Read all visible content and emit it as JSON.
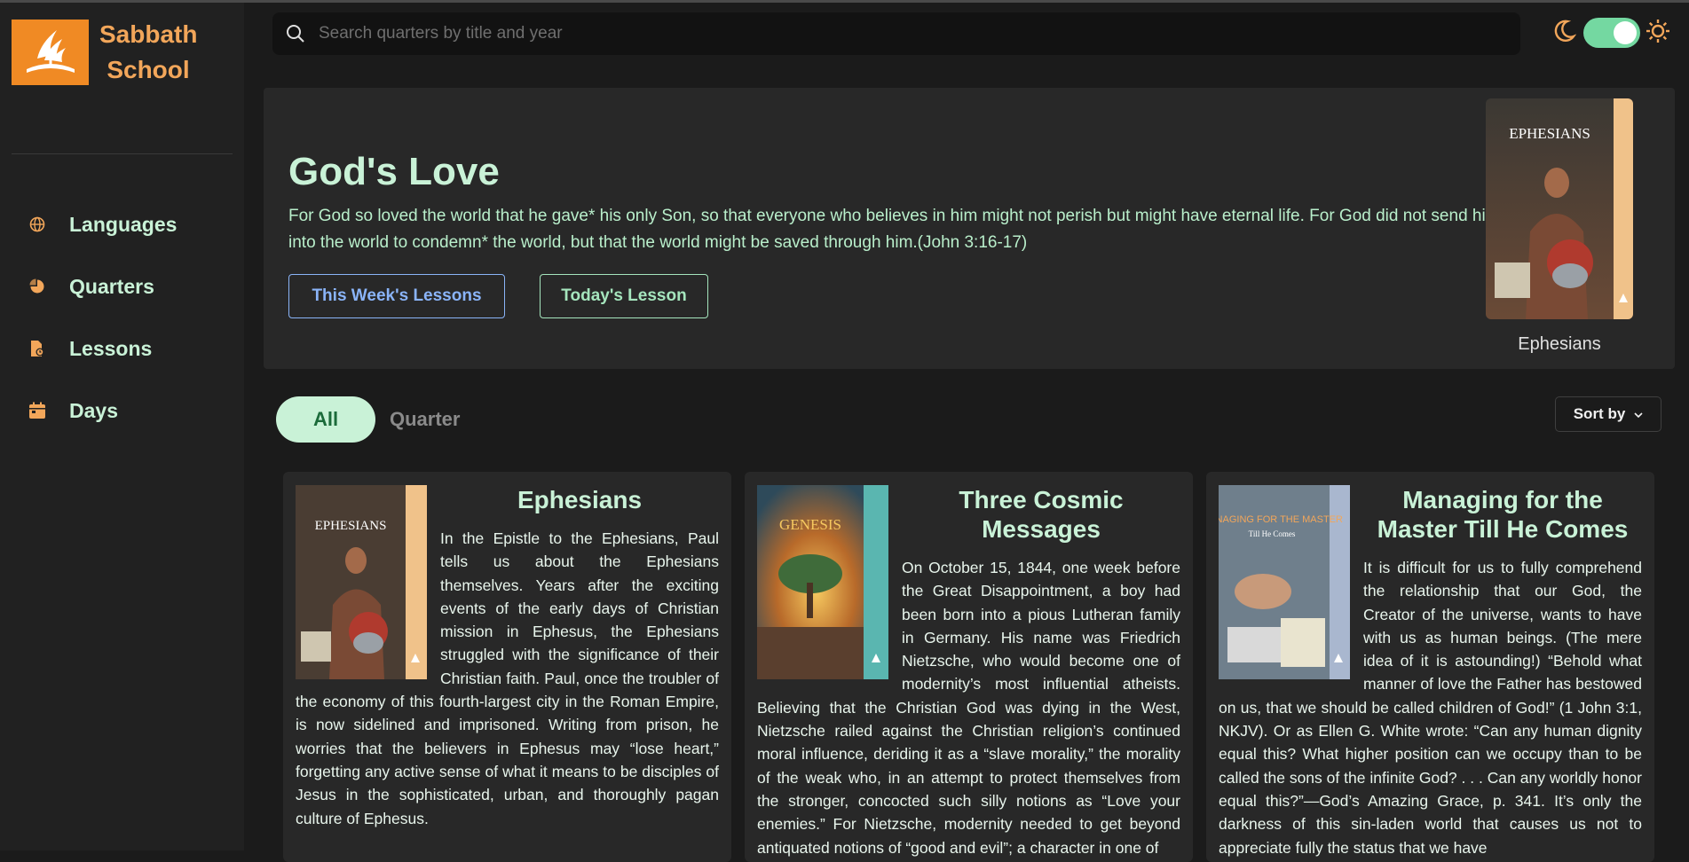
{
  "app": {
    "brand": "Sabbath School",
    "brand_line1": "Sabbath",
    "brand_line2": "School",
    "logo_icon": "adventist-flame-icon",
    "accent_color": "#f08a24"
  },
  "sidebar": {
    "items": [
      {
        "label": "Languages",
        "icon": "globe-icon"
      },
      {
        "label": "Quarters",
        "icon": "pie-icon"
      },
      {
        "label": "Lessons",
        "icon": "lesson-file-icon"
      },
      {
        "label": "Days",
        "icon": "calendar-icon"
      }
    ]
  },
  "search": {
    "placeholder": "Search quarters by title and year",
    "value": ""
  },
  "theme": {
    "moon_icon": "moon-icon",
    "sun_icon": "sun-icon",
    "toggle_on": true
  },
  "hero": {
    "title": "God's Love",
    "verse": "For God so loved the world that he gave* his only Son, so that everyone who believes in him might not perish but might have eternal life. For God did not send his Son into the world to condemn* the world, but that the world might be saved through him.(John 3:16-17)",
    "week_button": "This Week's Lessons",
    "today_button": "Today's Lesson",
    "cover_title": "EPHESIANS",
    "cover_label": "Ephesians"
  },
  "filters": {
    "all": "All",
    "quarter": "Quarter",
    "sort": "Sort by"
  },
  "quarters": [
    {
      "title": "Ephesians",
      "cover_title": "EPHESIANS",
      "description": "In the Epistle to the Ephesians, Paul tells us about the Ephesians themselves. Years after the exciting events of the early days of Christian mission in Ephesus, the Ephesians struggled with the significance of their Christian faith. Paul, once the troubler of the economy of this fourth-largest city in the Roman Empire, is now sidelined and imprisoned. Writing from prison, he worries that the believers in Ephesus may “lose heart,” forgetting any active sense of what it means to be disciples of Jesus in the sophisticated, urban, and thoroughly pagan culture of Ephesus."
    },
    {
      "title": "Three Cosmic Messages",
      "cover_title": "GENESIS",
      "description": "On October 15, 1844, one week before the Great Disappointment, a boy had been born into a pious Lutheran family in Germany. His name was Friedrich Nietzsche, who would become one of modernity’s most influential atheists. Believing that the Christian God was dying in the West, Nietzsche railed against the Christian religion’s continued moral influence, deriding it as a “slave morality,” the morality of the weak who, in an attempt to protect themselves from the stronger, concocted such silly notions as “Love your enemies.” For Nietzsche, modernity needed to get beyond antiquated notions of “good and evil”; a character in one of"
    },
    {
      "title": "Managing for the Master Till He Comes",
      "cover_title": "MANAGING FOR THE MASTER",
      "cover_subtitle": "Till He Comes",
      "description": "It is difficult for us to fully comprehend the relationship that our God, the Creator of the universe, wants to have with us as human beings. (The mere idea of it is astounding!) “Behold what manner of love the Father has bestowed on us, that we should be called children of God!” (1 John 3:1, NKJV). Or as Ellen G. White wrote: “Can any human dignity equal this? What higher position can we occupy than to be called the sons of the infinite God? . . . Can any worldly honor equal this?”—God’s Amazing Grace, p. 341. It’s only the darkness of this sin-laden world that causes us not to appreciate fully the status that we have"
    }
  ]
}
